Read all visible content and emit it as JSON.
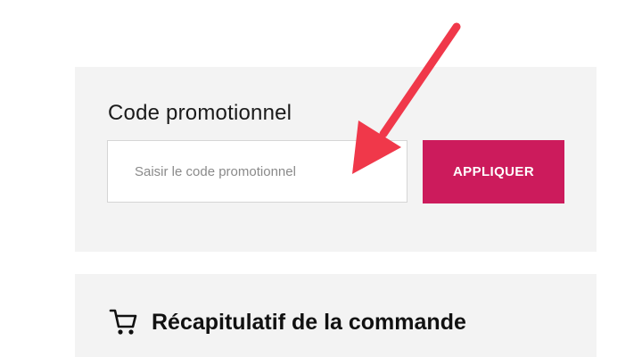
{
  "promo_code": {
    "title": "Code promotionnel",
    "placeholder": "Saisir le code promotionnel",
    "value": "",
    "apply_label": "APPLIQUER",
    "apply_color": "#cc1b5c"
  },
  "order_summary": {
    "icon": "shopping-cart-icon",
    "title": "Récapitulatif de la commande"
  },
  "annotation": {
    "icon": "red-arrow-icon",
    "color": "#f0384a"
  }
}
